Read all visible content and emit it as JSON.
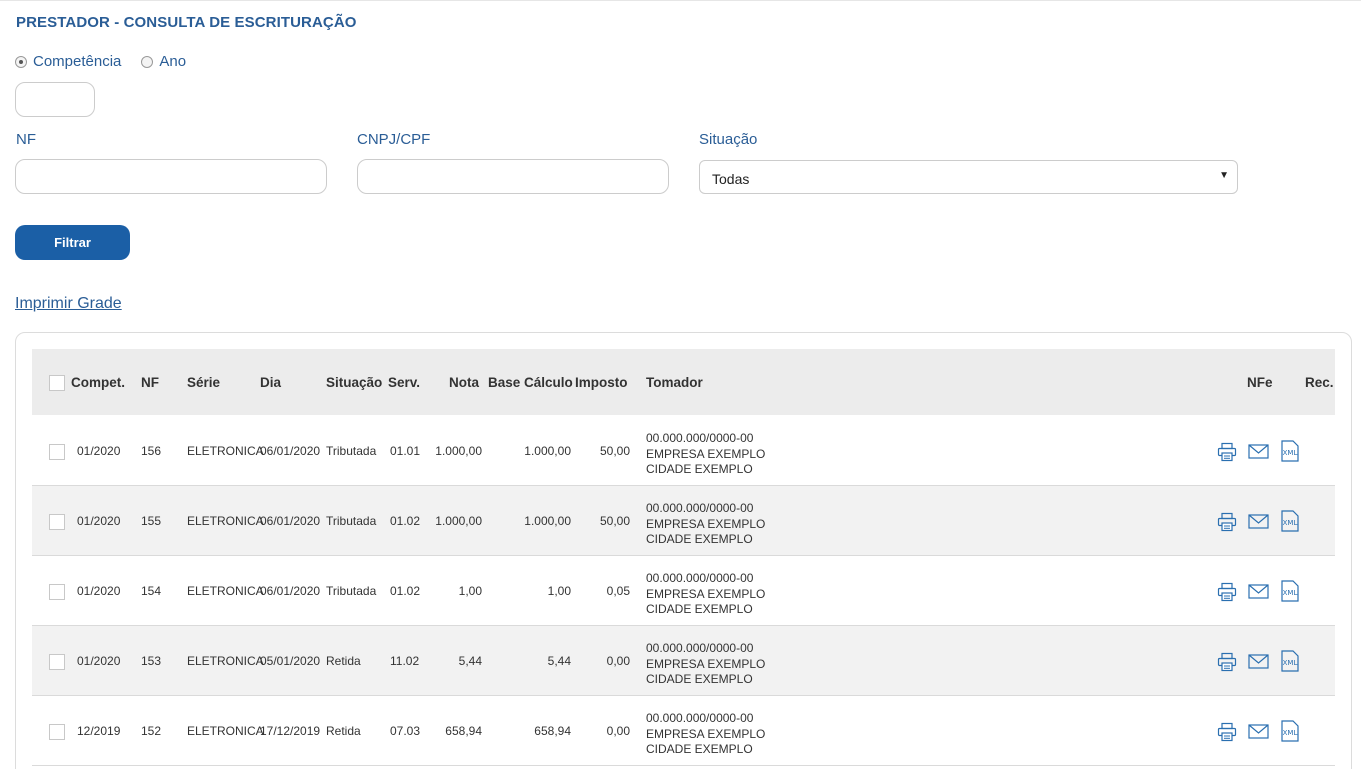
{
  "page_title": "PRESTADOR - CONSULTA DE ESCRITURAÇÃO",
  "filters": {
    "radio_competencia": "Competência",
    "radio_ano": "Ano",
    "competencia_value": "",
    "nf_label": "NF",
    "nf_value": "",
    "cnpj_label": "CNPJ/CPF",
    "cnpj_value": "",
    "situacao_label": "Situação",
    "situacao_value": "Todas",
    "filter_button": "Filtrar"
  },
  "print_link": "Imprimir Grade",
  "table": {
    "headers": {
      "compet": "Compet.",
      "nf": "NF",
      "serie": "Série",
      "dia": "Dia",
      "situacao": "Situação",
      "serv": "Serv.",
      "nota": "Nota",
      "base": "Base Cálculo",
      "imposto": "Imposto",
      "tomador": "Tomador",
      "nfe": "NFe",
      "rec": "Rec."
    },
    "rows": [
      {
        "compet": "01/2020",
        "nf": "156",
        "serie": "ELETRONICA",
        "dia": "06/01/2020",
        "situacao": "Tributada",
        "serv": "01.01",
        "nota": "1.000,00",
        "base": "1.000,00",
        "imposto": "50,00",
        "tomador_doc": "00.000.000/0000-00",
        "tomador_nome": "EMPRESA EXEMPLO",
        "tomador_cidade": "CIDADE EXEMPLO"
      },
      {
        "compet": "01/2020",
        "nf": "155",
        "serie": "ELETRONICA",
        "dia": "06/01/2020",
        "situacao": "Tributada",
        "serv": "01.02",
        "nota": "1.000,00",
        "base": "1.000,00",
        "imposto": "50,00",
        "tomador_doc": "00.000.000/0000-00",
        "tomador_nome": "EMPRESA EXEMPLO",
        "tomador_cidade": "CIDADE EXEMPLO"
      },
      {
        "compet": "01/2020",
        "nf": "154",
        "serie": "ELETRONICA",
        "dia": "06/01/2020",
        "situacao": "Tributada",
        "serv": "01.02",
        "nota": "1,00",
        "base": "1,00",
        "imposto": "0,05",
        "tomador_doc": "00.000.000/0000-00",
        "tomador_nome": "EMPRESA EXEMPLO",
        "tomador_cidade": "CIDADE EXEMPLO"
      },
      {
        "compet": "01/2020",
        "nf": "153",
        "serie": "ELETRONICA",
        "dia": "05/01/2020",
        "situacao": "Retida",
        "serv": "11.02",
        "nota": "5,44",
        "base": "5,44",
        "imposto": "0,00",
        "tomador_doc": "00.000.000/0000-00",
        "tomador_nome": "EMPRESA EXEMPLO",
        "tomador_cidade": "CIDADE EXEMPLO"
      },
      {
        "compet": "12/2019",
        "nf": "152",
        "serie": "ELETRONICA",
        "dia": "17/12/2019",
        "situacao": "Retida",
        "serv": "07.03",
        "nota": "658,94",
        "base": "658,94",
        "imposto": "0,00",
        "tomador_doc": "00.000.000/0000-00",
        "tomador_nome": "EMPRESA EXEMPLO",
        "tomador_cidade": "CIDADE EXEMPLO"
      }
    ],
    "row_icons": [
      "printer-icon",
      "email-icon",
      "xml-icon"
    ],
    "xml_icon_text": "XML"
  },
  "colors": {
    "accent": "#2a5d96",
    "button": "#1b5fa6",
    "header_bg": "#ececec",
    "alt_row_bg": "#f2f2f2"
  }
}
